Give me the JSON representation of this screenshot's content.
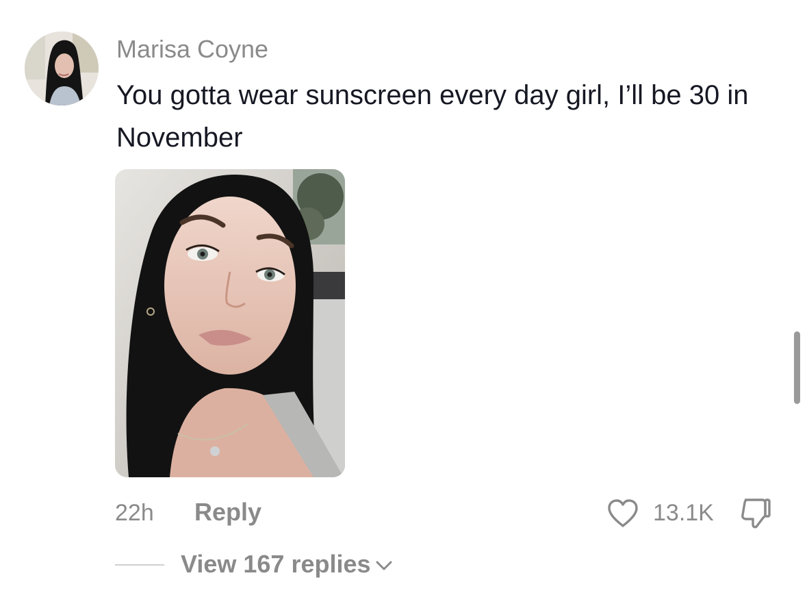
{
  "comment": {
    "author": "Marisa Coyne",
    "text": "You gotta wear sunscreen every day girl, I’ll be 30 in November",
    "time": "22h",
    "reply_label": "Reply",
    "like_count": "13.1K",
    "view_replies_label": "View 167 replies"
  },
  "icons": {
    "like": "heart-outline-icon",
    "dislike": "thumbs-down-icon",
    "expand": "chevron-down-icon"
  },
  "colors": {
    "text_primary": "#161823",
    "text_secondary": "#8a8a8a",
    "divider": "#d0d0d0"
  }
}
